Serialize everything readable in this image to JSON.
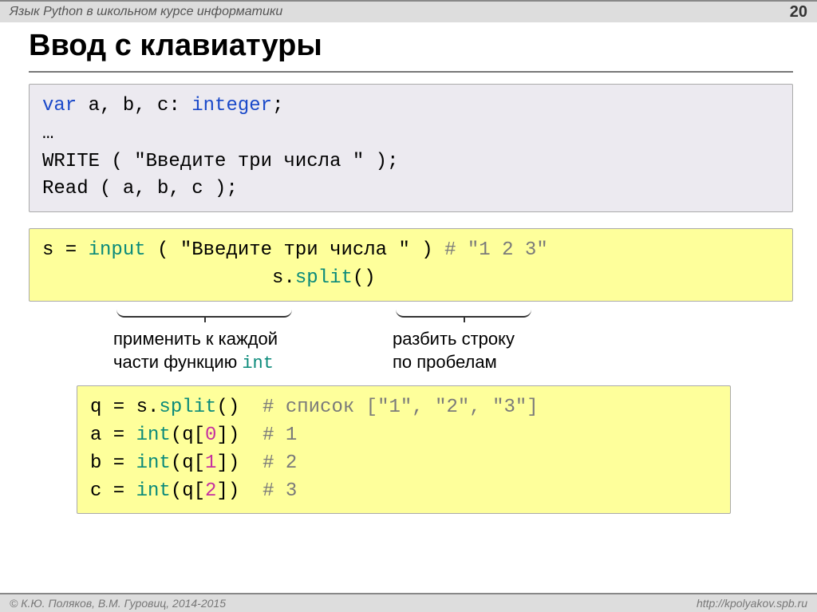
{
  "header": {
    "subtitle": "Язык Python в школьном курсе информатики",
    "page": "20"
  },
  "title": "Ввод с клавиатуры",
  "pascal": {
    "l1_var": "var",
    "l1_rest": " a, b, c: ",
    "l1_int": "integer",
    "l1_semi": ";",
    "l2": "…",
    "l3_write": "WRITE",
    "l3_arg": " ( \"Введите три числа \" );",
    "l4_read": "Read",
    "l4_arg": " ( a, b, c );"
  },
  "py1": {
    "l1a": "s = ",
    "l1_input": "input",
    "l1b": " ( \"Введите три числа \" ) ",
    "l1_comment": "# \"1 2 3\"",
    "l2_pad": "                    s.",
    "l2_split": "split",
    "l2_paren": "()"
  },
  "anno": {
    "left_l1": "применить к каждой",
    "left_l2_a": "части функцию ",
    "left_l2_b": "int",
    "right_l1": "разбить строку",
    "right_l2": "по пробелам"
  },
  "py2": {
    "l1a": "q = s.",
    "l1_split": "split",
    "l1b": "()  ",
    "l1_comment": "# список [\"1\", \"2\", \"3\"]",
    "l2a": "a = ",
    "l2_int": "int",
    "l2b": "(q[",
    "l2_idx": "0",
    "l2c": "])  ",
    "l2_comment": "# 1",
    "l3a": "b = ",
    "l3_int": "int",
    "l3b": "(q[",
    "l3_idx": "1",
    "l3c": "])  ",
    "l3_comment": "# 2",
    "l4a": "c = ",
    "l4_int": "int",
    "l4b": "(q[",
    "l4_idx": "2",
    "l4c": "])  ",
    "l4_comment": "# 3"
  },
  "footer": {
    "left": "© К.Ю. Поляков, В.М. Гуровиц, 2014-2015",
    "right": "http://kpolyakov.spb.ru"
  }
}
